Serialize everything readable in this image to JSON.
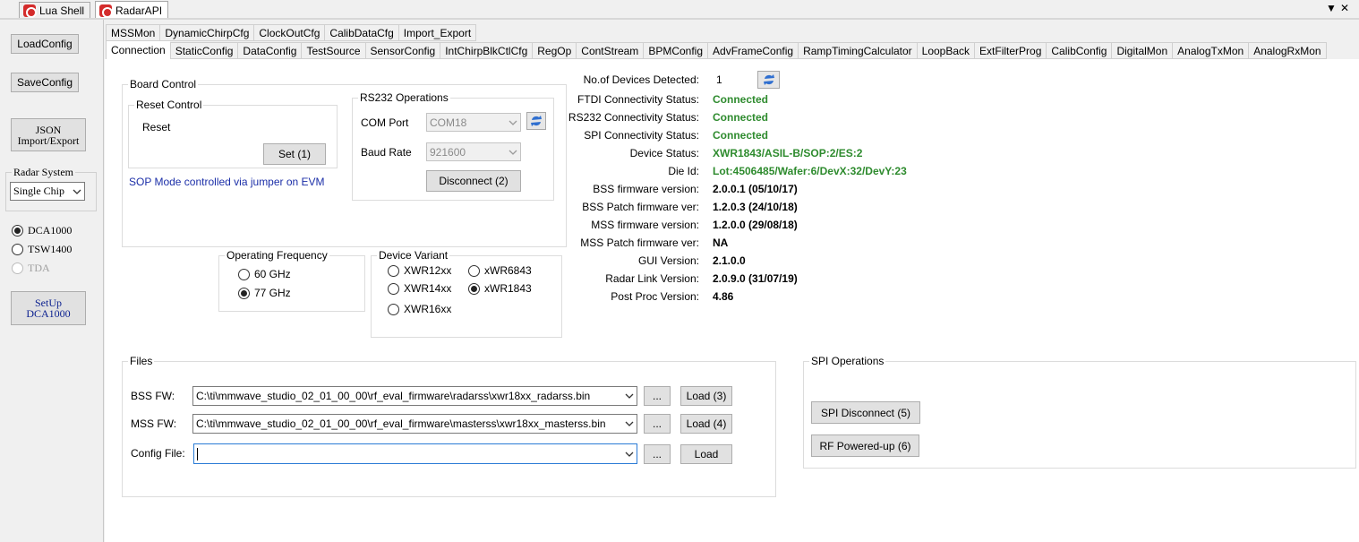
{
  "window_tabs": [
    {
      "label": "Lua Shell",
      "icon": "lua-shell-icon",
      "active": false
    },
    {
      "label": "RadarAPI",
      "icon": "radar-api-icon",
      "active": true
    }
  ],
  "window_controls": {
    "dropdown": "▼",
    "close": "✕"
  },
  "sidebar": {
    "load_config": "LoadConfig",
    "save_config": "SaveConfig",
    "json_line1": "JSON",
    "json_line2": "Import/Export",
    "radar_system_label": "Radar System",
    "radar_system_value": "Single Chip",
    "capture": [
      {
        "label": "DCA1000",
        "selected": true,
        "disabled": false
      },
      {
        "label": "TSW1400",
        "selected": false,
        "disabled": false
      },
      {
        "label": "TDA",
        "selected": false,
        "disabled": true
      }
    ],
    "setup_line1": "SetUp",
    "setup_line2": "DCA1000"
  },
  "tabs_row1": [
    "MSSMon",
    "DynamicChirpCfg",
    "ClockOutCfg",
    "CalibDataCfg",
    "Import_Export"
  ],
  "tabs_row2": [
    "Connection",
    "StaticConfig",
    "DataConfig",
    "TestSource",
    "SensorConfig",
    "IntChirpBlkCtlCfg",
    "RegOp",
    "ContStream",
    "BPMConfig",
    "AdvFrameConfig",
    "RampTimingCalculator",
    "LoopBack",
    "ExtFilterProg",
    "CalibConfig",
    "DigitalMon",
    "AnalogTxMon",
    "AnalogRxMon"
  ],
  "board_control": {
    "title": "Board Control",
    "reset_title": "Reset Control",
    "reset_label": "Reset",
    "set_button": "Set (1)",
    "sop_note": "SOP Mode controlled via jumper on EVM"
  },
  "rs232": {
    "title": "RS232 Operations",
    "com_label": "COM Port",
    "com_value": "COM18",
    "baud_label": "Baud Rate",
    "baud_value": "921600",
    "disconnect_button": "Disconnect (2)"
  },
  "operating_frequency": {
    "title": "Operating Frequency",
    "options": [
      {
        "label": "60 GHz",
        "selected": false
      },
      {
        "label": "77 GHz",
        "selected": true
      }
    ]
  },
  "device_variant": {
    "title": "Device Variant",
    "options": [
      {
        "label": "XWR12xx",
        "selected": false
      },
      {
        "label": "xWR6843",
        "selected": false
      },
      {
        "label": "XWR14xx",
        "selected": false
      },
      {
        "label": "xWR1843",
        "selected": true
      },
      {
        "label": "XWR16xx",
        "selected": false
      }
    ]
  },
  "status": {
    "devices_label": "No.of Devices Detected:",
    "devices_value": "1",
    "rows": [
      {
        "label": "FTDI Connectivity Status:",
        "value": "Connected",
        "color": "#2e8b2e"
      },
      {
        "label": "RS232 Connectivity Status:",
        "value": "Connected",
        "color": "#2e8b2e"
      },
      {
        "label": "SPI Connectivity Status:",
        "value": "Connected",
        "color": "#2e8b2e"
      },
      {
        "label": "Device Status:",
        "value": "XWR1843/ASIL-B/SOP:2/ES:2",
        "color": "#2e8b2e"
      },
      {
        "label": "Die Id:",
        "value": "Lot:4506485/Wafer:6/DevX:32/DevY:23",
        "color": "#2e8b2e"
      },
      {
        "label": "BSS firmware version:",
        "value": "2.0.0.1 (05/10/17)",
        "color": "#000000"
      },
      {
        "label": "BSS Patch firmware ver:",
        "value": "1.2.0.3 (24/10/18)",
        "color": "#000000"
      },
      {
        "label": "MSS firmware version:",
        "value": "1.2.0.0 (29/08/18)",
        "color": "#000000"
      },
      {
        "label": "MSS Patch firmware ver:",
        "value": "NA",
        "color": "#000000"
      },
      {
        "label": "GUI Version:",
        "value": "2.1.0.0",
        "color": "#000000"
      },
      {
        "label": "Radar Link Version:",
        "value": "2.0.9.0 (31/07/19)",
        "color": "#000000"
      },
      {
        "label": "Post Proc Version:",
        "value": "4.86",
        "color": "#000000"
      }
    ]
  },
  "files": {
    "title": "Files",
    "bss_label": "BSS FW:",
    "bss_value": "C:\\ti\\mmwave_studio_02_01_00_00\\rf_eval_firmware\\radarss\\xwr18xx_radarss.bin",
    "bss_load": "Load (3)",
    "mss_label": "MSS FW:",
    "mss_value": "C:\\ti\\mmwave_studio_02_01_00_00\\rf_eval_firmware\\masterss\\xwr18xx_masterss.bin",
    "mss_load": "Load (4)",
    "config_label": "Config File:",
    "config_value": "",
    "config_load": "Load",
    "browse": "..."
  },
  "spi": {
    "title": "SPI Operations",
    "disconnect_button": "SPI Disconnect (5)",
    "rf_button": "RF Powered-up (6)"
  }
}
